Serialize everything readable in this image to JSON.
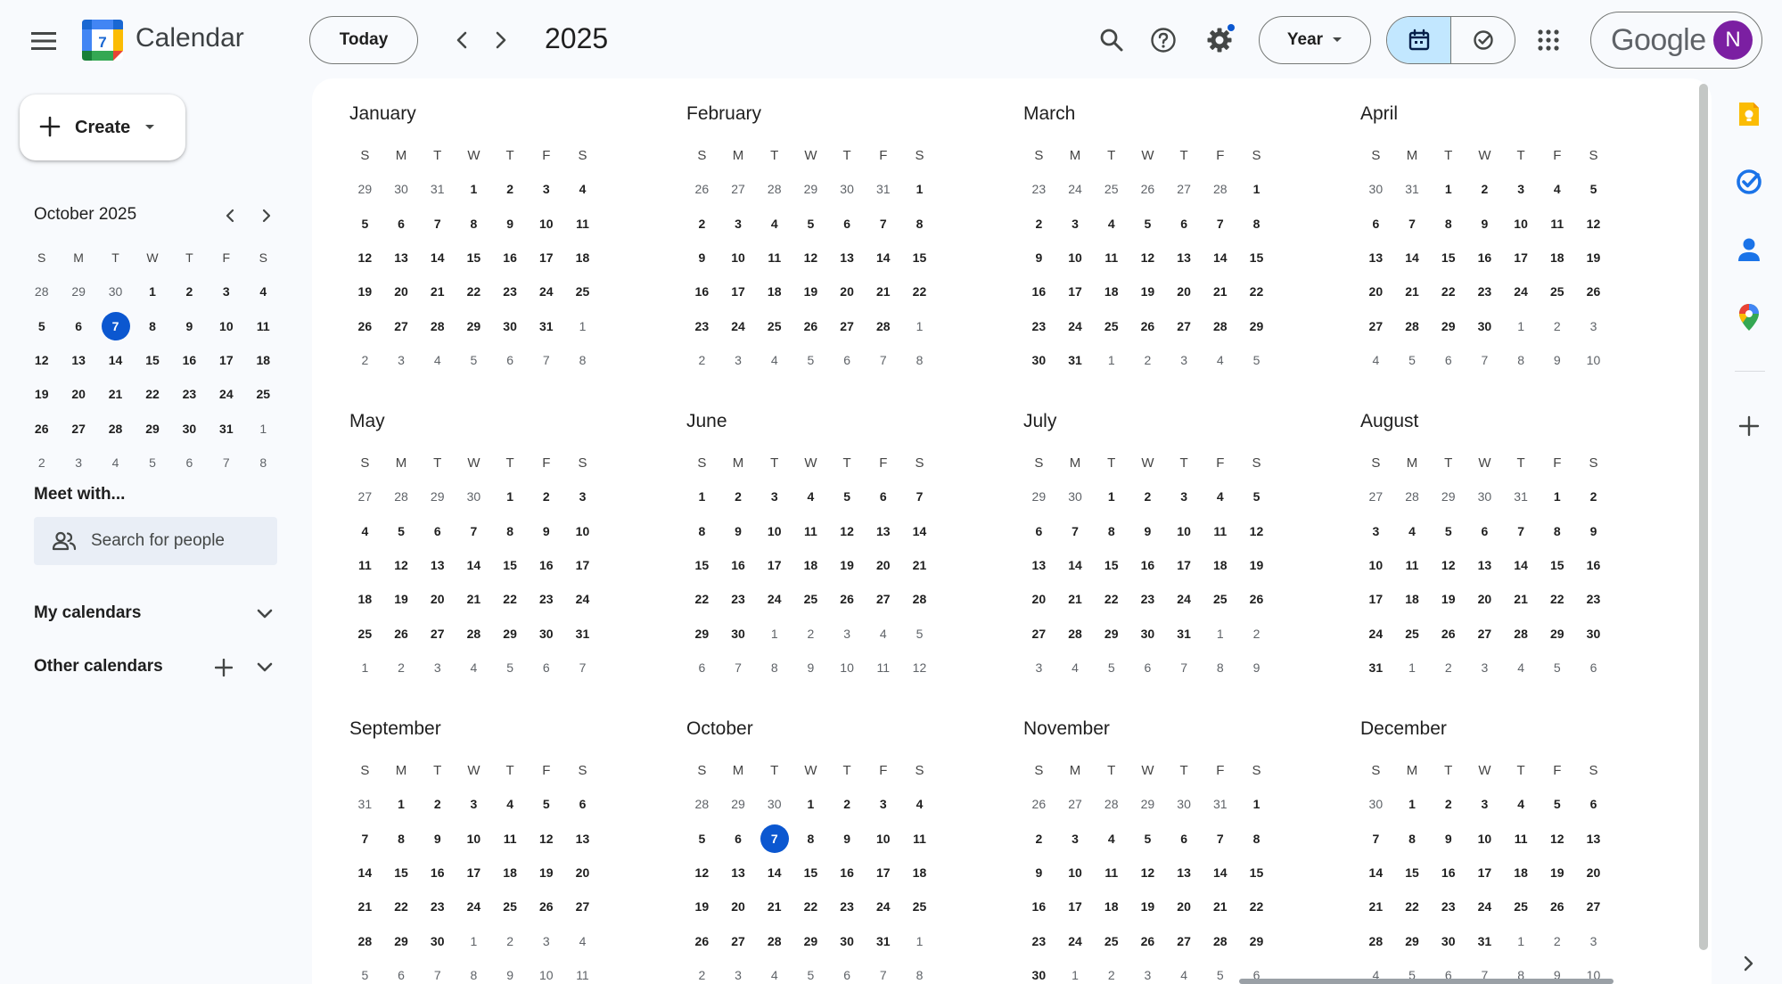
{
  "header": {
    "app_title": "Calendar",
    "logo_day": "7",
    "today_label": "Today",
    "current_year": "2025",
    "view_label": "Year",
    "account_brand": "Google",
    "avatar_initial": "N"
  },
  "sidebar": {
    "create_label": "Create",
    "mini_calendar": {
      "title": "October 2025",
      "weekdays": [
        "S",
        "M",
        "T",
        "W",
        "T",
        "F",
        "S"
      ],
      "weeks": [
        [
          "28",
          "29",
          "30",
          "1",
          "2",
          "3",
          "4"
        ],
        [
          "5",
          "6",
          "7",
          "8",
          "9",
          "10",
          "11"
        ],
        [
          "12",
          "13",
          "14",
          "15",
          "16",
          "17",
          "18"
        ],
        [
          "19",
          "20",
          "21",
          "22",
          "23",
          "24",
          "25"
        ],
        [
          "26",
          "27",
          "28",
          "29",
          "30",
          "31",
          "1"
        ],
        [
          "2",
          "3",
          "4",
          "5",
          "6",
          "7",
          "8"
        ]
      ],
      "today": "7"
    },
    "meet_with_title": "Meet with...",
    "search_people_placeholder": "Search for people",
    "my_calendars_label": "My calendars",
    "other_calendars_label": "Other calendars"
  },
  "year_view": {
    "weekdays": [
      "S",
      "M",
      "T",
      "W",
      "T",
      "F",
      "S"
    ],
    "today": {
      "month": "October",
      "day": "7"
    },
    "months": [
      {
        "name": "January",
        "weeks": [
          [
            "29",
            "30",
            "31",
            "1",
            "2",
            "3",
            "4"
          ],
          [
            "5",
            "6",
            "7",
            "8",
            "9",
            "10",
            "11"
          ],
          [
            "12",
            "13",
            "14",
            "15",
            "16",
            "17",
            "18"
          ],
          [
            "19",
            "20",
            "21",
            "22",
            "23",
            "24",
            "25"
          ],
          [
            "26",
            "27",
            "28",
            "29",
            "30",
            "31",
            "1"
          ],
          [
            "2",
            "3",
            "4",
            "5",
            "6",
            "7",
            "8"
          ]
        ]
      },
      {
        "name": "February",
        "weeks": [
          [
            "26",
            "27",
            "28",
            "29",
            "30",
            "31",
            "1"
          ],
          [
            "2",
            "3",
            "4",
            "5",
            "6",
            "7",
            "8"
          ],
          [
            "9",
            "10",
            "11",
            "12",
            "13",
            "14",
            "15"
          ],
          [
            "16",
            "17",
            "18",
            "19",
            "20",
            "21",
            "22"
          ],
          [
            "23",
            "24",
            "25",
            "26",
            "27",
            "28",
            "1"
          ],
          [
            "2",
            "3",
            "4",
            "5",
            "6",
            "7",
            "8"
          ]
        ]
      },
      {
        "name": "March",
        "weeks": [
          [
            "23",
            "24",
            "25",
            "26",
            "27",
            "28",
            "1"
          ],
          [
            "2",
            "3",
            "4",
            "5",
            "6",
            "7",
            "8"
          ],
          [
            "9",
            "10",
            "11",
            "12",
            "13",
            "14",
            "15"
          ],
          [
            "16",
            "17",
            "18",
            "19",
            "20",
            "21",
            "22"
          ],
          [
            "23",
            "24",
            "25",
            "26",
            "27",
            "28",
            "29"
          ],
          [
            "30",
            "31",
            "1",
            "2",
            "3",
            "4",
            "5"
          ]
        ]
      },
      {
        "name": "April",
        "weeks": [
          [
            "30",
            "31",
            "1",
            "2",
            "3",
            "4",
            "5"
          ],
          [
            "6",
            "7",
            "8",
            "9",
            "10",
            "11",
            "12"
          ],
          [
            "13",
            "14",
            "15",
            "16",
            "17",
            "18",
            "19"
          ],
          [
            "20",
            "21",
            "22",
            "23",
            "24",
            "25",
            "26"
          ],
          [
            "27",
            "28",
            "29",
            "30",
            "1",
            "2",
            "3"
          ],
          [
            "4",
            "5",
            "6",
            "7",
            "8",
            "9",
            "10"
          ]
        ]
      },
      {
        "name": "May",
        "weeks": [
          [
            "27",
            "28",
            "29",
            "30",
            "1",
            "2",
            "3"
          ],
          [
            "4",
            "5",
            "6",
            "7",
            "8",
            "9",
            "10"
          ],
          [
            "11",
            "12",
            "13",
            "14",
            "15",
            "16",
            "17"
          ],
          [
            "18",
            "19",
            "20",
            "21",
            "22",
            "23",
            "24"
          ],
          [
            "25",
            "26",
            "27",
            "28",
            "29",
            "30",
            "31"
          ],
          [
            "1",
            "2",
            "3",
            "4",
            "5",
            "6",
            "7"
          ]
        ]
      },
      {
        "name": "June",
        "weeks": [
          [
            "1",
            "2",
            "3",
            "4",
            "5",
            "6",
            "7"
          ],
          [
            "8",
            "9",
            "10",
            "11",
            "12",
            "13",
            "14"
          ],
          [
            "15",
            "16",
            "17",
            "18",
            "19",
            "20",
            "21"
          ],
          [
            "22",
            "23",
            "24",
            "25",
            "26",
            "27",
            "28"
          ],
          [
            "29",
            "30",
            "1",
            "2",
            "3",
            "4",
            "5"
          ],
          [
            "6",
            "7",
            "8",
            "9",
            "10",
            "11",
            "12"
          ]
        ]
      },
      {
        "name": "July",
        "weeks": [
          [
            "29",
            "30",
            "1",
            "2",
            "3",
            "4",
            "5"
          ],
          [
            "6",
            "7",
            "8",
            "9",
            "10",
            "11",
            "12"
          ],
          [
            "13",
            "14",
            "15",
            "16",
            "17",
            "18",
            "19"
          ],
          [
            "20",
            "21",
            "22",
            "23",
            "24",
            "25",
            "26"
          ],
          [
            "27",
            "28",
            "29",
            "30",
            "31",
            "1",
            "2"
          ],
          [
            "3",
            "4",
            "5",
            "6",
            "7",
            "8",
            "9"
          ]
        ]
      },
      {
        "name": "August",
        "weeks": [
          [
            "27",
            "28",
            "29",
            "30",
            "31",
            "1",
            "2"
          ],
          [
            "3",
            "4",
            "5",
            "6",
            "7",
            "8",
            "9"
          ],
          [
            "10",
            "11",
            "12",
            "13",
            "14",
            "15",
            "16"
          ],
          [
            "17",
            "18",
            "19",
            "20",
            "21",
            "22",
            "23"
          ],
          [
            "24",
            "25",
            "26",
            "27",
            "28",
            "29",
            "30"
          ],
          [
            "31",
            "1",
            "2",
            "3",
            "4",
            "5",
            "6"
          ]
        ]
      },
      {
        "name": "September",
        "weeks": [
          [
            "31",
            "1",
            "2",
            "3",
            "4",
            "5",
            "6"
          ],
          [
            "7",
            "8",
            "9",
            "10",
            "11",
            "12",
            "13"
          ],
          [
            "14",
            "15",
            "16",
            "17",
            "18",
            "19",
            "20"
          ],
          [
            "21",
            "22",
            "23",
            "24",
            "25",
            "26",
            "27"
          ],
          [
            "28",
            "29",
            "30",
            "1",
            "2",
            "3",
            "4"
          ],
          [
            "5",
            "6",
            "7",
            "8",
            "9",
            "10",
            "11"
          ]
        ]
      },
      {
        "name": "October",
        "weeks": [
          [
            "28",
            "29",
            "30",
            "1",
            "2",
            "3",
            "4"
          ],
          [
            "5",
            "6",
            "7",
            "8",
            "9",
            "10",
            "11"
          ],
          [
            "12",
            "13",
            "14",
            "15",
            "16",
            "17",
            "18"
          ],
          [
            "19",
            "20",
            "21",
            "22",
            "23",
            "24",
            "25"
          ],
          [
            "26",
            "27",
            "28",
            "29",
            "30",
            "31",
            "1"
          ],
          [
            "2",
            "3",
            "4",
            "5",
            "6",
            "7",
            "8"
          ]
        ]
      },
      {
        "name": "November",
        "weeks": [
          [
            "26",
            "27",
            "28",
            "29",
            "30",
            "31",
            "1"
          ],
          [
            "2",
            "3",
            "4",
            "5",
            "6",
            "7",
            "8"
          ],
          [
            "9",
            "10",
            "11",
            "12",
            "13",
            "14",
            "15"
          ],
          [
            "16",
            "17",
            "18",
            "19",
            "20",
            "21",
            "22"
          ],
          [
            "23",
            "24",
            "25",
            "26",
            "27",
            "28",
            "29"
          ],
          [
            "30",
            "1",
            "2",
            "3",
            "4",
            "5",
            "6"
          ]
        ]
      },
      {
        "name": "December",
        "weeks": [
          [
            "30",
            "1",
            "2",
            "3",
            "4",
            "5",
            "6"
          ],
          [
            "7",
            "8",
            "9",
            "10",
            "11",
            "12",
            "13"
          ],
          [
            "14",
            "15",
            "16",
            "17",
            "18",
            "19",
            "20"
          ],
          [
            "21",
            "22",
            "23",
            "24",
            "25",
            "26",
            "27"
          ],
          [
            "28",
            "29",
            "30",
            "31",
            "1",
            "2",
            "3"
          ],
          [
            "4",
            "5",
            "6",
            "7",
            "8",
            "9",
            "10"
          ]
        ]
      }
    ]
  },
  "side_panel": {
    "apps": [
      "keep-icon",
      "tasks-icon",
      "contacts-icon",
      "maps-icon",
      "add-icon"
    ]
  },
  "colors": {
    "accent": "#0b57d0",
    "toggle_active": "#c2e7ff",
    "avatar_bg": "#7b1fa2",
    "background": "#f8fafd"
  }
}
